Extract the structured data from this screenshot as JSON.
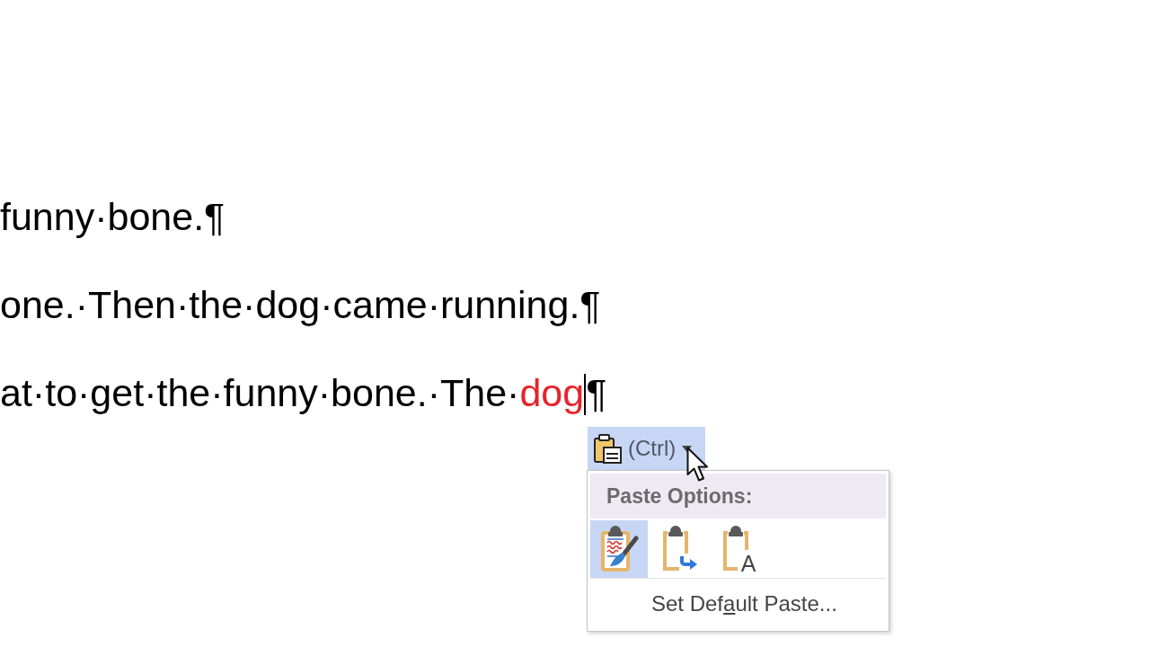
{
  "document": {
    "lines": [
      {
        "runs": [
          {
            "text": "funny·bone.¶",
            "color": "#000000",
            "cursor": false
          }
        ]
      },
      {
        "runs": [
          {
            "text": "one.·Then·the·dog·came·running.¶",
            "color": "#000000",
            "cursor": false
          }
        ]
      },
      {
        "runs": [
          {
            "text": "at·to·get·the·funny·bone.·The·",
            "color": "#000000",
            "cursor": false
          },
          {
            "text": "dog",
            "color": "#e7242b",
            "cursor": true
          },
          {
            "text": "¶",
            "color": "#000000",
            "cursor": false
          }
        ]
      }
    ]
  },
  "paste_button": {
    "label": "(Ctrl)",
    "expanded": true
  },
  "paste_menu": {
    "header": "Paste Options:",
    "options": [
      {
        "kind": "keep-source",
        "selected": true
      },
      {
        "kind": "merge",
        "selected": false
      },
      {
        "kind": "text-only",
        "selected": false,
        "glyph": "A"
      }
    ],
    "items": [
      {
        "parts": [
          {
            "text": "Set Def",
            "underline": false
          },
          {
            "text": "a",
            "underline": true
          },
          {
            "text": "ult Paste...",
            "underline": false
          }
        ]
      }
    ]
  }
}
